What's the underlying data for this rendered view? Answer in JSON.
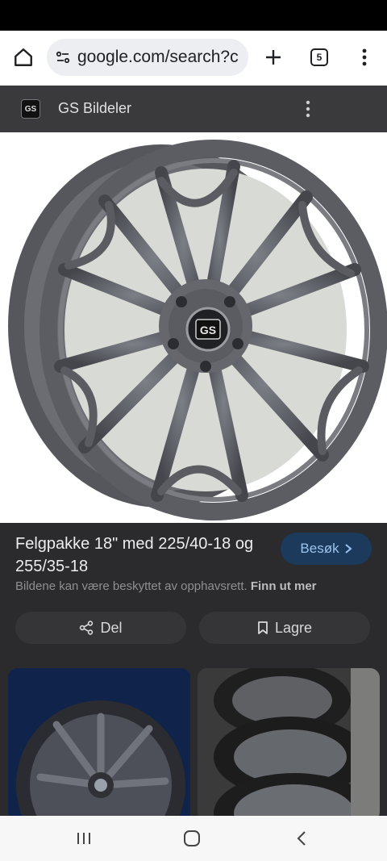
{
  "browser": {
    "url": "google.com/search?c",
    "tab_count": "5",
    "icons": [
      "home-icon",
      "site-info-icon",
      "plus-icon",
      "tabs-icon",
      "more-vert-icon"
    ]
  },
  "source": {
    "logo_text": "GS",
    "name": "GS Bildeler"
  },
  "image": {
    "center_cap_text": "GS"
  },
  "result": {
    "title": "Felgpakke 18\" med 225/40-18 og 255/35-18",
    "visit_label": "Besøk",
    "copyright_text": "Bildene kan være beskyttet av opphavsrett.",
    "copyright_link": "Finn ut mer",
    "share_label": "Del",
    "save_label": "Lagre"
  },
  "colors": {
    "chrome_bg": "#ffffff",
    "dim_overlay": "#2b2b2d",
    "visit_button": "#1b3a5c",
    "visit_text": "#9cc3ec"
  }
}
